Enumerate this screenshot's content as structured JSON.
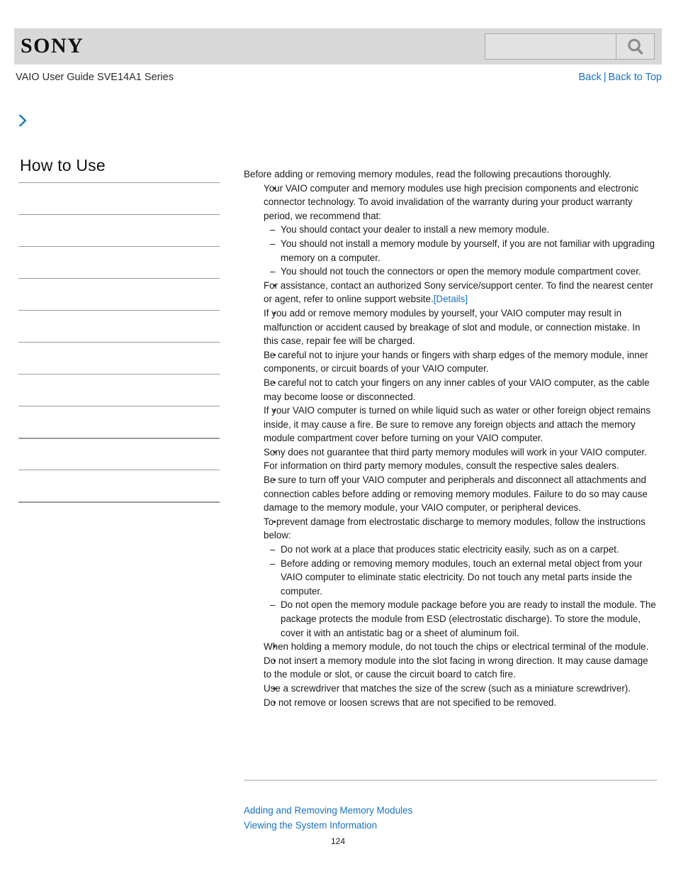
{
  "header": {
    "logo_text": "SONY",
    "search": {
      "value": "",
      "placeholder": "",
      "icon": "search-icon"
    }
  },
  "subheader": {
    "guide_title": "VAIO User Guide SVE14A1 Series",
    "back_label": "Back",
    "separator": "|",
    "back_to_top_label": "Back to Top"
  },
  "breadcrumb": {
    "chevron_icon": "chevron-right-icon",
    "text": "",
    "accent_color": "#1c7cc0"
  },
  "sidebar": {
    "title": "How to Use",
    "items": [
      {
        "label": ""
      },
      {
        "label": ""
      },
      {
        "label": ""
      },
      {
        "label": ""
      },
      {
        "label": ""
      },
      {
        "label": ""
      },
      {
        "label": ""
      },
      {
        "label": ""
      },
      {
        "label": ""
      },
      {
        "label": ""
      },
      {
        "label": ""
      }
    ]
  },
  "content": {
    "lead": "Before adding or removing memory modules, read the following precautions thoroughly.",
    "bullets": [
      {
        "text": "Your VAIO computer and memory modules use high precision components and electronic connector technology. To avoid invalidation of the warranty during your product warranty period, we recommend that:",
        "subitems": [
          "You should contact your dealer to install a new memory module.",
          "You should not install a memory module by yourself, if you are not familiar with upgrading memory on a computer.",
          "You should not touch the connectors or open the memory module compartment cover."
        ]
      },
      {
        "text": "For assistance, contact an authorized Sony service/support center. To find the nearest center or agent, refer to online support website.",
        "link_label": "[Details]",
        "subitems": []
      },
      {
        "text": "If you add or remove memory modules by yourself, your VAIO computer may result in malfunction or accident caused by breakage of slot and module, or connection mistake. In this case, repair fee will be charged.",
        "subitems": []
      },
      {
        "text": "Be careful not to injure your hands or fingers with sharp edges of the memory module, inner components, or circuit boards of your VAIO computer.",
        "subitems": []
      },
      {
        "text": "Be careful not to catch your fingers on any inner cables of your VAIO computer, as the cable may become loose or disconnected.",
        "subitems": []
      },
      {
        "text": "If your VAIO computer is turned on while liquid such as water or other foreign object remains inside, it may cause a fire. Be sure to remove any foreign objects and attach the memory module compartment cover before turning on your VAIO computer.",
        "subitems": []
      },
      {
        "text": "Sony does not guarantee that third party memory modules will work in your VAIO computer. For information on third party memory modules, consult the respective sales dealers.",
        "subitems": []
      },
      {
        "text": "Be sure to turn off your VAIO computer and peripherals and disconnect all attachments and connection cables before adding or removing memory modules. Failure to do so may cause damage to the memory module, your VAIO computer, or peripheral devices.",
        "subitems": []
      },
      {
        "text": "To prevent damage from electrostatic discharge to memory modules, follow the instructions below:",
        "subitems": [
          "Do not work at a place that produces static electricity easily, such as on a carpet.",
          "Before adding or removing memory modules, touch an external metal object from your VAIO computer to eliminate static electricity. Do not touch any metal parts inside the computer.",
          "Do not open the memory module package before you are ready to install the module. The package protects the module from ESD (electrostatic discharge). To store the module, cover it with an antistatic bag or a sheet of aluminum foil."
        ]
      },
      {
        "text": "When holding a memory module, do not touch the chips or electrical terminal of the module.",
        "subitems": []
      },
      {
        "text": "Do not insert a memory module into the slot facing in wrong direction. It may cause damage to the module or slot, or cause the circuit board to catch fire.",
        "subitems": []
      },
      {
        "text": "Use a screwdriver that matches the size of the screw (such as a miniature screwdriver).",
        "subitems": []
      },
      {
        "text": "Do not remove or loosen screws that are not specified to be removed.",
        "subitems": []
      }
    ]
  },
  "footer": {
    "links": [
      "Adding and Removing Memory Modules",
      "Viewing the System Information"
    ],
    "page_number": "124"
  },
  "colors": {
    "link": "#1672c6",
    "header_bg": "#d8d8d8",
    "rule": "#9a9a9a",
    "text": "#1a1a1a"
  }
}
